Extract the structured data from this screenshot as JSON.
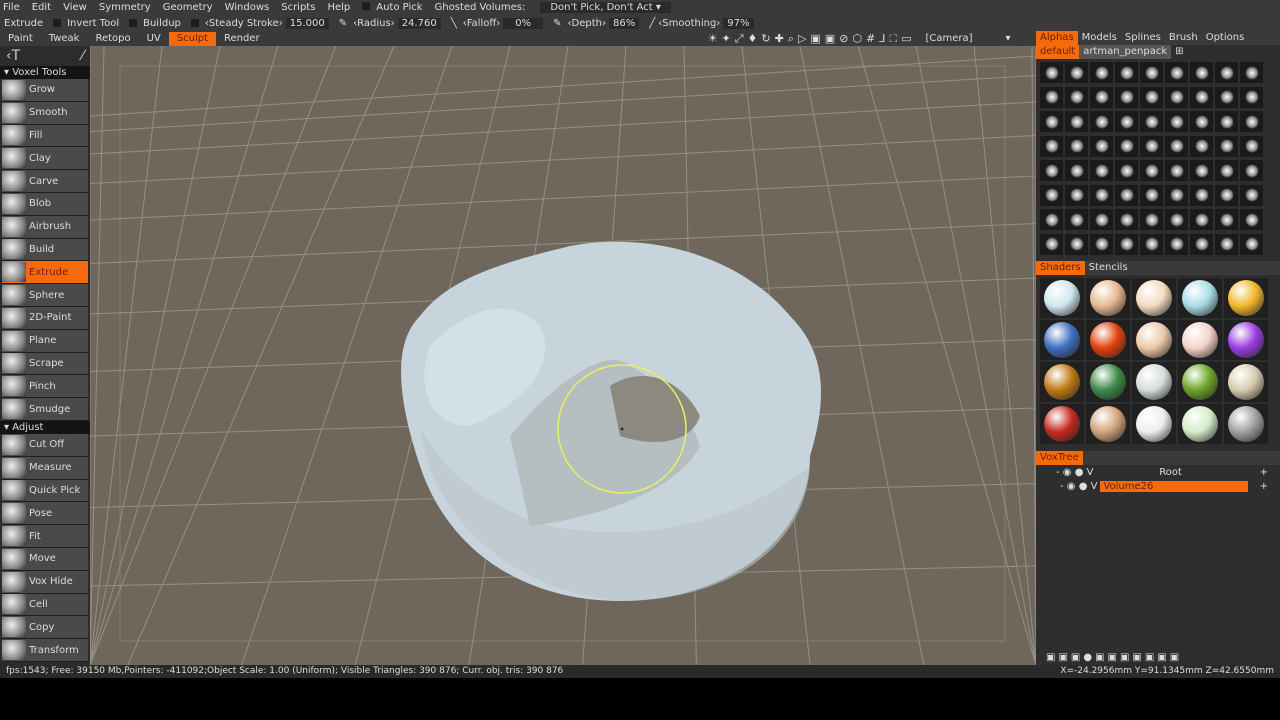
{
  "menu": [
    "File",
    "Edit",
    "View",
    "Symmetry",
    "Geometry",
    "Windows",
    "Scripts",
    "Help"
  ],
  "menu_extra": {
    "auto_pick": "Auto Pick",
    "ghosted_label": "Ghosted Volumes:",
    "ghosted_value": "Don't Pick, Don't Act"
  },
  "toolbar": {
    "tool": "Extrude",
    "invert": "Invert Tool",
    "buildup": "Buildup",
    "steady_label": "‹Steady Stroke›",
    "steady": "15.000",
    "radius_label": "‹Radius›",
    "radius": "24.760",
    "falloff_label": "‹Falloff›",
    "falloff": "0%",
    "depth_label": "‹Depth›",
    "depth": "86%",
    "smoothing_label": "‹Smoothing›",
    "smoothing": "97%"
  },
  "tabs": [
    "Paint",
    "Tweak",
    "Retopo",
    "UV",
    "Sculpt",
    "Render"
  ],
  "camera": "[Camera]",
  "left": {
    "section1": "Voxel Tools",
    "tools1": [
      "Grow",
      "Smooth",
      "Fill",
      "Clay",
      "Carve",
      "Blob",
      "Airbrush",
      "Build",
      "Extrude",
      "Sphere",
      "2D-Paint",
      "Plane",
      "Scrape",
      "Pinch",
      "Smudge"
    ],
    "section2": "Adjust",
    "tools2": [
      "Cut Off",
      "Measure",
      "Quick Pick",
      "Pose",
      "Fit",
      "Move",
      "Vox Hide",
      "Cell",
      "Copy",
      "Transform"
    ]
  },
  "right": {
    "tabs": [
      "Alphas",
      "Models",
      "Splines",
      "Brush",
      "Options"
    ],
    "sets": [
      "default",
      "artman_penpack"
    ],
    "shader_tabs": [
      "Shaders",
      "Stencils"
    ],
    "shader_colors": [
      "#cfe6ee",
      "#e8b890",
      "#f3dcc0",
      "#a9dde6",
      "#f2b62a",
      "#3e6fc0",
      "#e2410e",
      "#ecc8a8",
      "#f4d4c8",
      "#9a3ee0",
      "#c07a14",
      "#3f8a4a",
      "#d8dcdc",
      "#6ea42a",
      "#d8ccae",
      "#c42a22",
      "#d2a27a",
      "#eeeeee",
      "#d4ecc8",
      "#a0a0a0"
    ],
    "voxtree_tab": "VoxTree",
    "root": "Root",
    "volume": "Volume26"
  },
  "status": {
    "left": "fps:1543; Free: 39150 Mb,Pointers: -411092;Object Scale: 1.00 (Uniform); Visible Triangles: 390 876; Curr. obj. tris: 390 876",
    "right": "X=-24.2956mm Y=91.1345mm Z=42.6550mm"
  },
  "colors": {
    "accent": "#f56a0a",
    "viewport": "#6f675c",
    "mesh": "#c9d8e0",
    "brush": "#e8f060"
  }
}
